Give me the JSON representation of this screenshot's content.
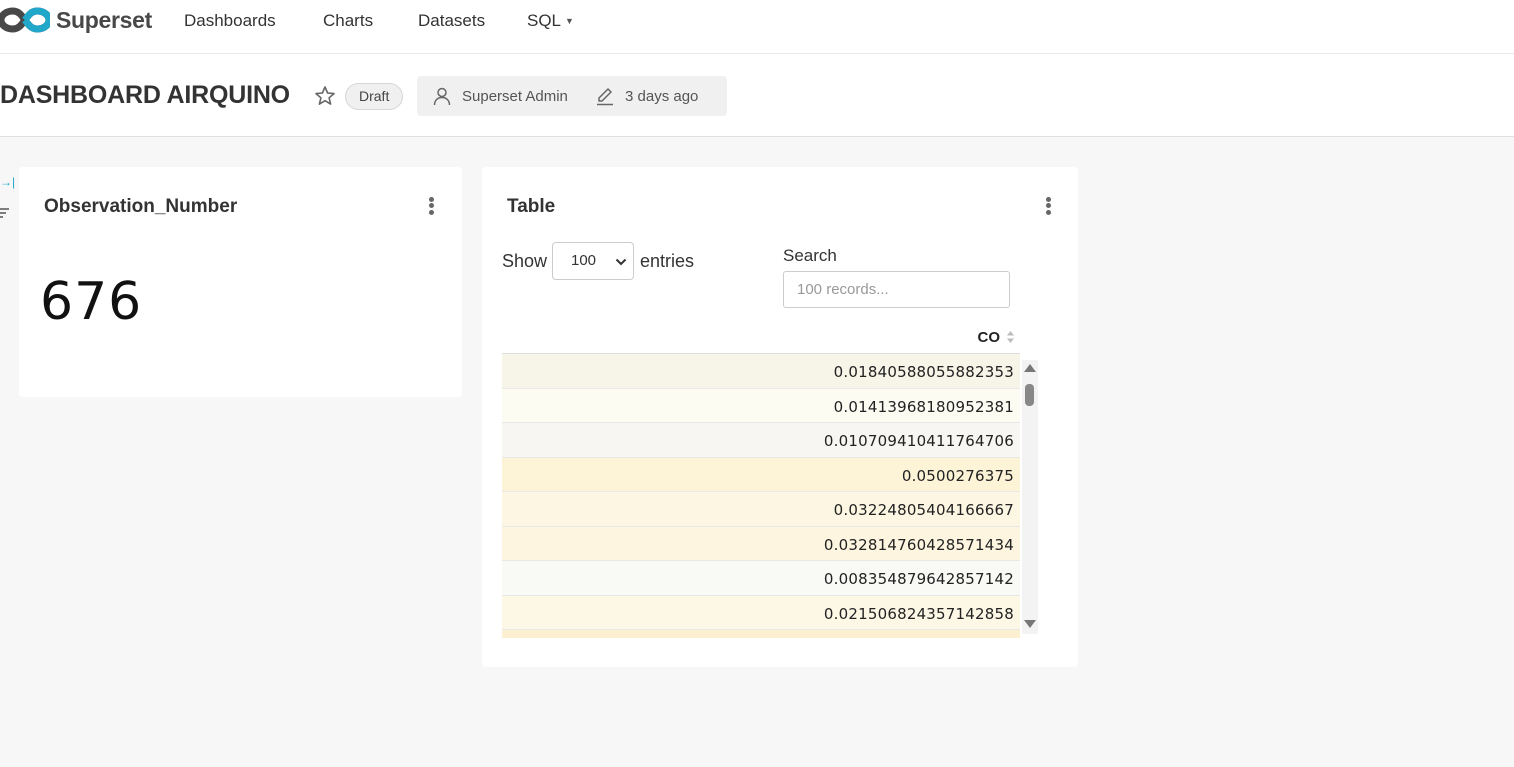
{
  "nav": {
    "brand": "Superset",
    "links": [
      "Dashboards",
      "Charts",
      "Datasets",
      "SQL"
    ]
  },
  "header": {
    "title": "DASHBOARD AIRQUINO",
    "status": "Draft",
    "owner": "Superset Admin",
    "modified": "3 days ago"
  },
  "bignumber_card": {
    "title": "Observation_Number",
    "value": "676"
  },
  "table_card": {
    "title": "Table",
    "show_label": "Show",
    "page_size": "100",
    "entries_label": "entries",
    "search_label": "Search",
    "search_placeholder": "100 records...",
    "column": "CO",
    "rows": [
      "0.01840588055882353",
      "0.01413968180952381",
      "0.010709410411764706",
      "0.0500276375",
      "0.03224805404166667",
      "0.032814760428571434",
      "0.008354879642857142",
      "0.021506824357142858",
      ""
    ]
  },
  "colors": {
    "accent": "#20a7c9",
    "row_shading": [
      "#f7f4e8",
      "#fdfcf3",
      "#f7f6f2",
      "#fdf3d7",
      "#fcf6e3",
      "#fdf5df",
      "#f9f9f6",
      "#fdf8e6",
      "#fdf0d0"
    ]
  }
}
